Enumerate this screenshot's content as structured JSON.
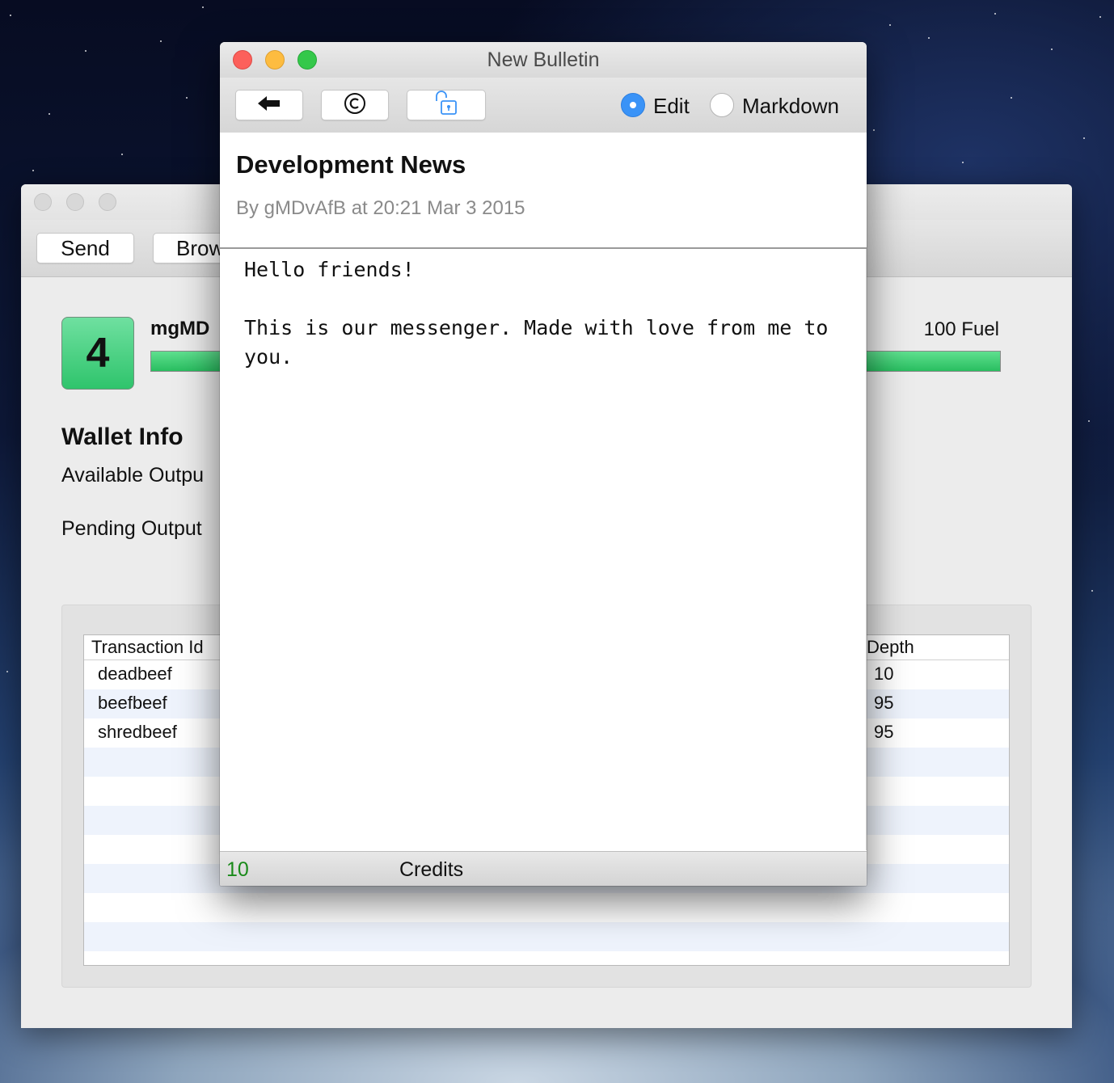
{
  "wallet_window": {
    "toolbar": {
      "send_label": "Send",
      "browse_label": "Brow"
    },
    "score": "4",
    "address_label": "mgMD",
    "fuel_label": "100 Fuel",
    "fuel_fraction": 1.0,
    "wallet_title": "Wallet Info",
    "available_outputs": "Available Outpu",
    "pending_outputs": "Pending Output",
    "table": {
      "headers": {
        "txid": "Transaction Id",
        "depth": "Depth"
      },
      "rows": [
        {
          "txid": "deadbeef",
          "depth": "10"
        },
        {
          "txid": "beefbeef",
          "depth": "95"
        },
        {
          "txid": "shredbeef",
          "depth": "95"
        }
      ]
    }
  },
  "bulletin_window": {
    "title": "New Bulletin",
    "toolbar": {
      "back_icon": "arrow-left-icon",
      "copyright_icon": "copyright-icon",
      "lock_icon": "unlock-icon",
      "mode_options": [
        "Edit",
        "Markdown"
      ],
      "selected_mode": "Edit"
    },
    "post": {
      "title": "Development News",
      "meta": "By gMDvAfB at 20:21 Mar 3 2015",
      "body": "Hello friends!\n\nThis is our messenger. Made with love from me to\nyou."
    },
    "footer": {
      "credits_value": "10",
      "credits_label": "Credits"
    },
    "colors": {
      "accent": "#3a93f7",
      "credits": "#1a8a1a"
    }
  }
}
